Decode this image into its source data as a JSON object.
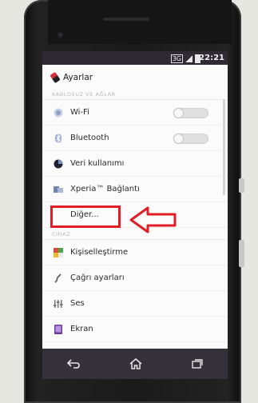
{
  "status_bar": {
    "network": "3G",
    "time": "22:21"
  },
  "title": "Ayarlar",
  "sections": [
    {
      "header": "KABLOSUZ VE AĞLAR",
      "items": [
        {
          "label": "Wi-Fi",
          "icon": "wifi-icon",
          "toggle": "off"
        },
        {
          "label": "Bluetooth",
          "icon": "bluetooth-icon",
          "toggle": "off"
        },
        {
          "label": "Veri kullanımı",
          "icon": "data-usage-icon"
        },
        {
          "label": "Xperia™ Bağlantı",
          "icon": "xperia-connectivity-icon"
        },
        {
          "label": "Diğer...",
          "icon": "none",
          "highlighted": true
        }
      ]
    },
    {
      "header": "CİHAZ",
      "items": [
        {
          "label": "Kişiselleştirme",
          "icon": "personalization-icon"
        },
        {
          "label": "Çağrı ayarları",
          "icon": "call-settings-icon"
        },
        {
          "label": "Ses",
          "icon": "sound-icon"
        },
        {
          "label": "Ekran",
          "icon": "display-icon"
        }
      ]
    }
  ],
  "nav_bar": {
    "back": "back-icon",
    "home": "home-icon",
    "recents": "recents-icon"
  },
  "annotation": {
    "color": "#e11d26"
  }
}
